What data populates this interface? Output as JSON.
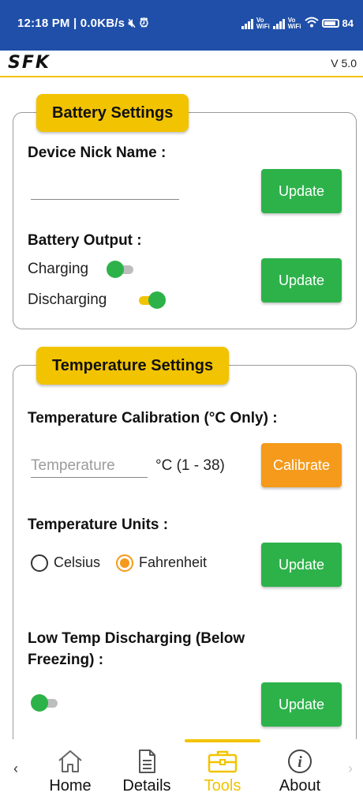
{
  "status_bar": {
    "time_net": "12:18 PM | 0.0KB/s",
    "battery": "84"
  },
  "header": {
    "logo": "SFK",
    "version": "V 5.0"
  },
  "battery_settings": {
    "title": "Battery Settings",
    "nick_name_label": "Device Nick Name :",
    "nick_name_value": "",
    "nick_update_label": "Update",
    "output_label": "Battery Output :",
    "charging_label": "Charging",
    "charging_on": false,
    "discharging_label": "Discharging",
    "discharging_on": true,
    "output_update_label": "Update"
  },
  "temperature_settings": {
    "title": "Temperature Settings",
    "calibration_label": "Temperature Calibration (°C Only) :",
    "calibration_placeholder": "Temperature",
    "calibration_range": "°C (1 - 38)",
    "calibrate_label": "Calibrate",
    "units_label": "Temperature Units :",
    "unit_options": [
      "Celsius",
      "Fahrenheit"
    ],
    "selected_unit": "Fahrenheit",
    "units_update_label": "Update",
    "low_temp_label_line1": "Low Temp Discharging (Below",
    "low_temp_label_line2": "Freezing) :",
    "low_temp_on": false,
    "low_temp_update_label": "Update"
  },
  "bottom_nav": {
    "items": [
      {
        "label": "Home",
        "icon": "home-icon"
      },
      {
        "label": "Details",
        "icon": "document-icon"
      },
      {
        "label": "Tools",
        "icon": "toolbox-icon",
        "active": true
      },
      {
        "label": "About",
        "icon": "info-icon"
      }
    ],
    "prev_arrow": "‹",
    "next_arrow": "›"
  },
  "colors": {
    "status_bar": "#1f4fa8",
    "accent_yellow": "#f2c300",
    "button_green": "#2db24a",
    "button_orange": "#f59a1b"
  }
}
